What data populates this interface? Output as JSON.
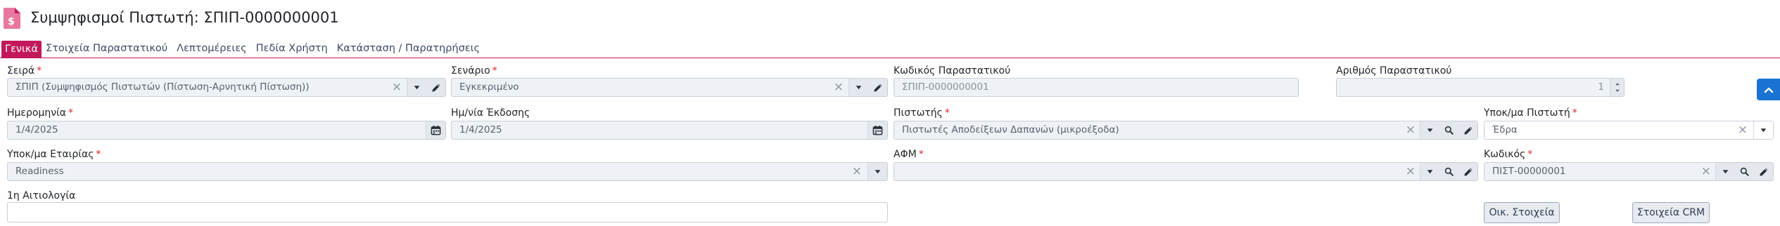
{
  "header": {
    "title": "Συμψηφισμοί Πιστωτή: ΣΠΙΠ-0000000001"
  },
  "tabs": [
    {
      "label": "Γενικά"
    },
    {
      "label": "Στοιχεία Παραστατικού"
    },
    {
      "label": "Λεπτομέρειες"
    },
    {
      "label": "Πεδία Χρήστη"
    },
    {
      "label": "Κατάσταση / Παρατηρήσεις"
    }
  ],
  "form": {
    "seira": {
      "label": "Σειρά",
      "value": "ΣΠΙΠ (Συμψηφισμός Πιστωτών (Πίστωση-Αρνητική Πίστωση))"
    },
    "senario": {
      "label": "Σενάριο",
      "value": "Εγκεκριμένο"
    },
    "kodikos_parastatikou": {
      "label": "Κωδικός Παραστατικού",
      "placeholder": "ΣΠΙΠ-0000000001"
    },
    "arithmos_parastatikou": {
      "label": "Αριθμός Παραστατικού",
      "value": "1"
    },
    "imerominia": {
      "label": "Ημερομηνία",
      "value": "1/4/2025"
    },
    "imnia_ekdosis": {
      "label": "Ημ/νία Έκδοσης",
      "value": "1/4/2025"
    },
    "pistotis": {
      "label": "Πιστωτής",
      "value": "Πιστωτές Αποδείξεων Δαπανών (μικροέξοδα)"
    },
    "ypokma_pistoti": {
      "label": "Υποκ/μα Πιστωτή",
      "value": "Έδρα"
    },
    "ypokma_etairias": {
      "label": "Υποκ/μα Εταιρίας",
      "value": "Readiness"
    },
    "afm": {
      "label": "ΑΦΜ",
      "value": ""
    },
    "kodikos": {
      "label": "Κωδικός",
      "value": "ΠΙΣΤ-00000001"
    },
    "aitiologia": {
      "label": "1η Αιτιολογία",
      "value": ""
    }
  },
  "actions": {
    "oik_stoixeia": "Οικ. Στοιχεία",
    "stoixeia_crm": "Στοιχεία CRM"
  },
  "colors": {
    "accent": "#c2185b",
    "primary": "#1a73d2",
    "required": "#dc2626"
  },
  "icons": [
    "document-dollar-icon",
    "clear-icon",
    "chevron-down-icon",
    "pencil-icon",
    "calendar-icon",
    "search-icon",
    "chevron-up-icon"
  ]
}
